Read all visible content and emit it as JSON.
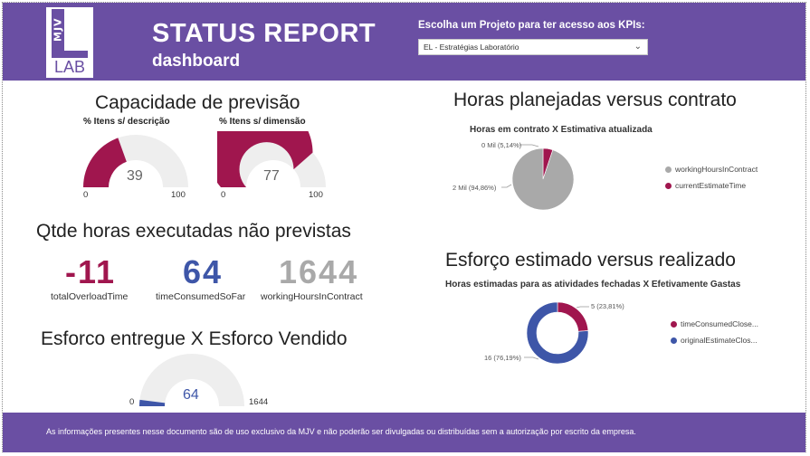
{
  "header": {
    "logo_text": "MJV",
    "logo_sub": "LAB",
    "title": "STATUS REPORT",
    "subtitle": "dashboard",
    "selector_label": "Escolha um Projeto para ter acesso aos KPIs:",
    "selector_value": "EL - Estratégias Laboratório"
  },
  "section_titles": {
    "capacidade": "Capacidade de previsão",
    "horas_planejadas": "Horas planejadas versus contrato",
    "qtde_horas": "Qtde horas executadas não previstas",
    "esforco_estimado": "Esforço estimado versus realizado",
    "esforco_entregue": "Esforco entregue X Esforco Vendido"
  },
  "gauges": [
    {
      "label": "% Itens s/ descrição",
      "value": "39",
      "min": "0",
      "max": "100",
      "value_num": 39,
      "max_num": 100,
      "color": "#a0164e"
    },
    {
      "label": "% Itens s/ dimensão",
      "value": "77",
      "min": "0",
      "max": "100",
      "value_num": 77,
      "max_num": 100,
      "color": "#a0164e"
    },
    {
      "label": "",
      "value": "64",
      "min": "0",
      "max": "1644",
      "value_num": 64,
      "max_num": 1644,
      "color": "#3e56a8"
    }
  ],
  "kpis": [
    {
      "value": "-11",
      "label": "totalOverloadTime",
      "color": "#a0164e"
    },
    {
      "value": "64",
      "label": "timeConsumedSoFar",
      "color": "#3e56a8"
    },
    {
      "value": "1644",
      "label": "workingHoursInContract",
      "color": "#a9a9a9"
    }
  ],
  "pie_chart": {
    "title": "Horas em contrato X Estimativa atualizada",
    "labels": [
      "0 Mil (5,14%)",
      "2 Mil (94,86%)"
    ]
  },
  "donut_chart": {
    "title": "Horas estimadas para as atividades fechadas X Efetivamente Gastas",
    "labels": [
      "5 (23,81%)",
      "16 (76,19%)"
    ]
  },
  "chart_data": [
    {
      "type": "pie",
      "title": "Horas em contrato X Estimativa atualizada",
      "series": [
        {
          "name": "currentEstimateTime",
          "value": 5.14,
          "color": "#a0164e"
        },
        {
          "name": "workingHoursInContract",
          "value": 94.86,
          "color": "#a9a9a9"
        }
      ],
      "legend_position": "right"
    },
    {
      "type": "pie",
      "title": "Horas estimadas para as atividades fechadas X Efetivamente Gastas",
      "donut": true,
      "series": [
        {
          "name": "timeConsumedClose...",
          "value": 5,
          "color": "#a0164e"
        },
        {
          "name": "originalEstimateClos...",
          "value": 16,
          "color": "#3e56a8"
        }
      ],
      "legend_position": "right"
    }
  ],
  "footer": {
    "text": "As informações presentes nesse documento são de uso exclusivo da MJV e não poderão ser divulgadas ou distribuídas sem a autorização por escrito da empresa."
  }
}
